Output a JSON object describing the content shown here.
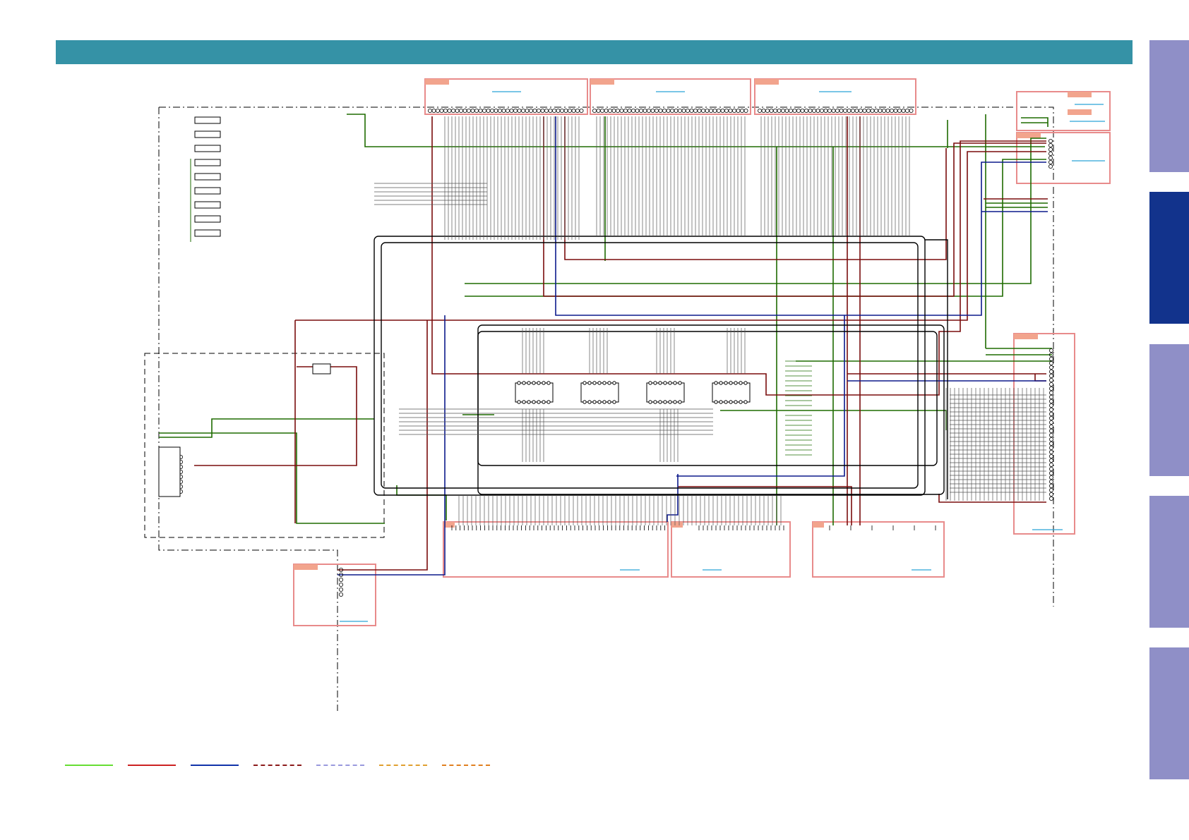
{
  "colors": {
    "header": "#3592a6",
    "tab_inactive": "#8f8fc7",
    "tab_active": "#12338c",
    "green": "#1e6b00",
    "red": "#7a0d0d",
    "blue": "#0d1a8c",
    "black": "#000000",
    "box": "#e88b8b",
    "label": "#f2a48d",
    "link": "#2aa4d8"
  },
  "side_tabs": [
    {
      "state": "inactive"
    },
    {
      "state": "active"
    },
    {
      "state": "inactive"
    },
    {
      "state": "inactive"
    },
    {
      "state": "inactive"
    }
  ],
  "legend": [
    {
      "color": "#66dd33",
      "style": "solid"
    },
    {
      "color": "#cc2222",
      "style": "solid"
    },
    {
      "color": "#1133aa",
      "style": "solid"
    },
    {
      "color": "#8b1a1a",
      "style": "dashed"
    },
    {
      "color": "#9999dd",
      "style": "dashed"
    },
    {
      "color": "#e0a030",
      "style": "dashed"
    },
    {
      "color": "#e08020",
      "style": "dashed"
    }
  ]
}
